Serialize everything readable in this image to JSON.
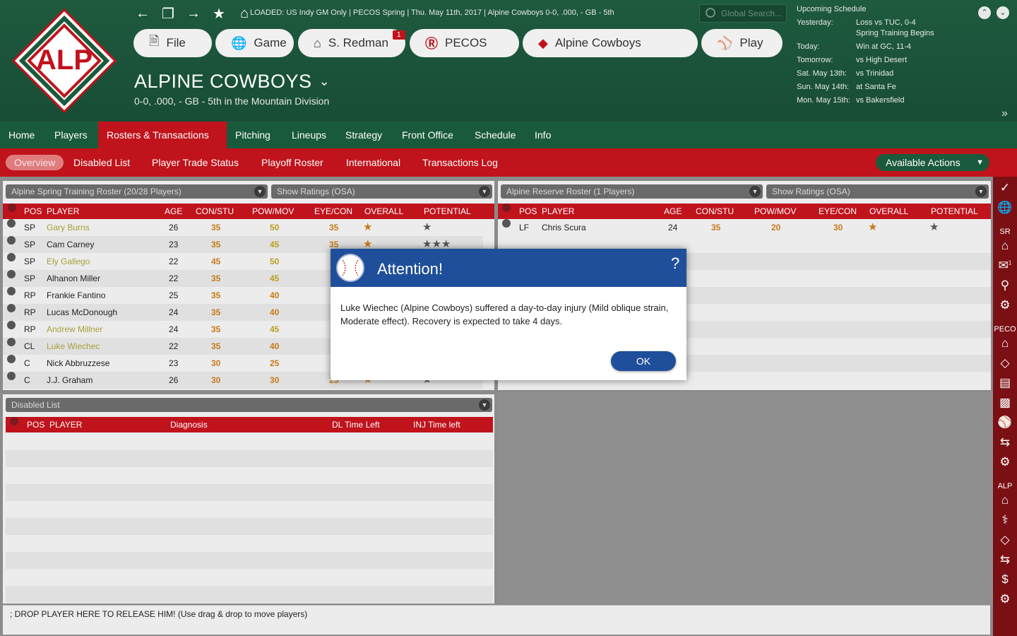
{
  "header": {
    "loaded_text": "LOADED: US Indy GM Only  |  PECOS Spring  |  Thu. May 11th, 2017  |  Alpine Cowboys   0-0, .000, - GB - 5th",
    "search_placeholder": "Global Search...",
    "logo_text": "ALP",
    "buttons": {
      "file": "File",
      "game": "Game",
      "manager": "S. Redman",
      "manager_badge": "1",
      "pecos": "PECOS",
      "team": "Alpine Cowboys",
      "play": "Play"
    },
    "team_title": "ALPINE COWBOYS",
    "team_sub": "0-0, .000, - GB - 5th in the  Mountain Division"
  },
  "schedule": {
    "heading": "Upcoming Schedule",
    "rows": [
      {
        "label": "Yesterday:",
        "value": "Loss vs TUC, 0-4"
      },
      {
        "label": "",
        "value": "Spring Training Begins"
      },
      {
        "label": "Today:",
        "value": "Win at GC, 11-4"
      },
      {
        "label": "Tomorrow:",
        "value": "vs High Desert"
      },
      {
        "label": "Sat. May 13th:",
        "value": "vs Trinidad"
      },
      {
        "label": "Sun. May 14th:",
        "value": "at Santa Fe"
      },
      {
        "label": "Mon. May 15th:",
        "value": "vs Bakersfield"
      }
    ]
  },
  "mainnav": [
    "Home",
    "Players",
    "Rosters & Transactions",
    "Pitching",
    "Lineups",
    "Strategy",
    "Front Office",
    "Schedule",
    "Info"
  ],
  "subnav": [
    "Overview",
    "Disabled List",
    "Player Trade Status",
    "Playoff Roster",
    "International",
    "Transactions Log"
  ],
  "available_actions": "Available Actions",
  "left_roster": {
    "select": "Alpine Spring Training Roster (20/28 Players)",
    "ratings_select": "Show Ratings (OSA)",
    "headers": {
      "pos": "POS",
      "player": "PLAYER",
      "age": "AGE",
      "c1": "CON/STU",
      "c2": "POW/MOV",
      "c3": "EYE/CON",
      "overall": "OVERALL",
      "potential": "POTENTIAL"
    },
    "rows": [
      {
        "pos": "SP",
        "name": "Gary Burns",
        "age": "26",
        "c1": "35",
        "c2": "50",
        "c3": "35",
        "ov": "★",
        "pot": "★"
      },
      {
        "pos": "SP",
        "name": "Cam Carney",
        "age": "23",
        "c1": "35",
        "c2": "45",
        "c3": "35",
        "ov": "★",
        "pot": "★★★"
      },
      {
        "pos": "SP",
        "name": "Ely Gallego",
        "age": "22",
        "c1": "45",
        "c2": "50",
        "c3": "",
        "ov": "",
        "pot": ""
      },
      {
        "pos": "SP",
        "name": "Alhanon Miller",
        "age": "22",
        "c1": "35",
        "c2": "45",
        "c3": "",
        "ov": "",
        "pot": ""
      },
      {
        "pos": "RP",
        "name": "Frankie Fantino",
        "age": "25",
        "c1": "35",
        "c2": "40",
        "c3": "",
        "ov": "",
        "pot": ""
      },
      {
        "pos": "RP",
        "name": "Lucas McDonough",
        "age": "24",
        "c1": "35",
        "c2": "40",
        "c3": "",
        "ov": "",
        "pot": ""
      },
      {
        "pos": "RP",
        "name": "Andrew Millner",
        "age": "24",
        "c1": "35",
        "c2": "45",
        "c3": "",
        "ov": "",
        "pot": ""
      },
      {
        "pos": "CL",
        "name": "Luke Wiechec",
        "age": "22",
        "c1": "35",
        "c2": "40",
        "c3": "",
        "ov": "",
        "pot": ""
      },
      {
        "pos": "C",
        "name": "Nick Abbruzzese",
        "age": "23",
        "c1": "30",
        "c2": "25",
        "c3": "",
        "ov": "",
        "pot": ""
      },
      {
        "pos": "C",
        "name": "J.J. Graham",
        "age": "26",
        "c1": "30",
        "c2": "30",
        "c3": "25",
        "ov": "★",
        "pot": "★"
      }
    ]
  },
  "disabled_list": {
    "select": "Disabled List",
    "headers": {
      "pos": "POS",
      "player": "PLAYER",
      "diag": "Diagnosis",
      "dl": "DL Time Left",
      "inj": "INJ Time left"
    }
  },
  "right_roster": {
    "select": "Alpine Reserve Roster (1 Players)",
    "ratings_select": "Show Ratings (OSA)",
    "headers": {
      "pos": "POS",
      "player": "PLAYER",
      "age": "AGE",
      "c1": "CON/STU",
      "c2": "POW/MOV",
      "c3": "EYE/CON",
      "overall": "OVERALL",
      "potential": "POTENTIAL"
    },
    "rows": [
      {
        "pos": "LF",
        "name": "Chris Scura",
        "age": "24",
        "c1": "35",
        "c2": "20",
        "c3": "30",
        "ov": "★",
        "pot": "★"
      }
    ]
  },
  "sidebar_labels": {
    "sr": "SR",
    "sr_badge": "1",
    "peco": "PECO",
    "alp": "ALP"
  },
  "release_text": "; DROP PLAYER HERE TO RELEASE HIM! (Use drag & drop to move players)",
  "modal": {
    "title": "Attention!",
    "help": "?",
    "body": "Luke Wiechec (Alpine Cowboys) suffered a day-to-day injury (Mild oblique strain, Moderate effect). Recovery is expected to take 4 days.",
    "ok": "OK"
  },
  "colors": {
    "green": "#1a5a3c",
    "red": "#c0131c",
    "modal_blue": "#1f4f9a"
  }
}
